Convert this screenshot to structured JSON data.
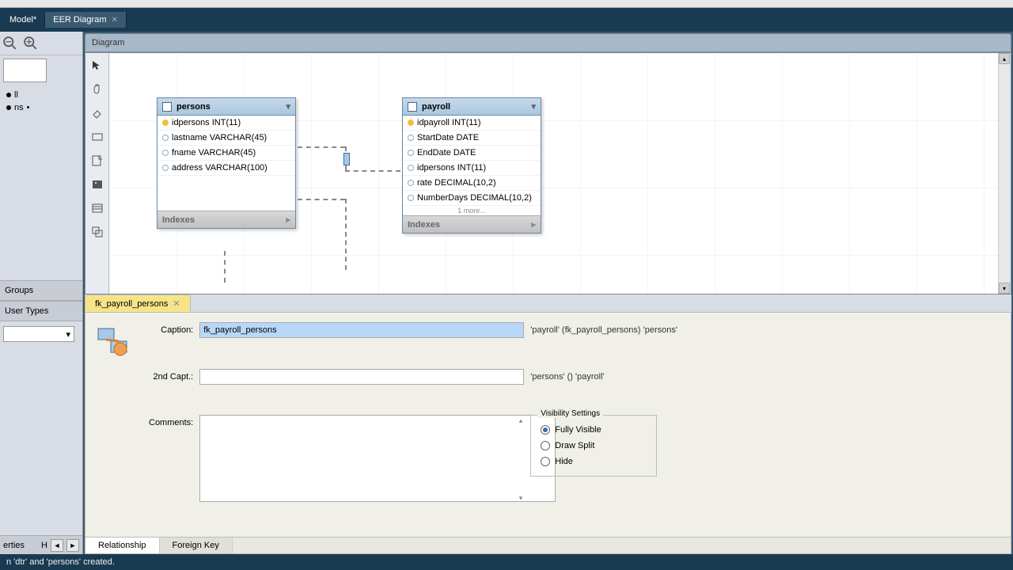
{
  "tabs": {
    "model": "Model*",
    "diagram": "EER Diagram"
  },
  "diagram_header": "Diagram",
  "left": {
    "tree_items": [
      "ll",
      "ns"
    ],
    "groups": "Groups",
    "user_types": "User Types"
  },
  "entities": {
    "persons": {
      "name": "persons",
      "cols": [
        {
          "key": true,
          "label": "idpersons INT(11)"
        },
        {
          "key": false,
          "label": "lastname VARCHAR(45)"
        },
        {
          "key": false,
          "label": "fname VARCHAR(45)"
        },
        {
          "key": false,
          "label": "address VARCHAR(100)"
        }
      ],
      "indexes": "Indexes"
    },
    "payroll": {
      "name": "payroll",
      "cols": [
        {
          "key": true,
          "label": "idpayroll INT(11)"
        },
        {
          "key": false,
          "label": "StartDate DATE"
        },
        {
          "key": false,
          "label": "EndDate DATE"
        },
        {
          "key": false,
          "label": "idpersons INT(11)"
        },
        {
          "key": false,
          "label": "rate DECIMAL(10,2)"
        },
        {
          "key": false,
          "label": "NumberDays DECIMAL(10,2)"
        }
      ],
      "more": "1 more...",
      "indexes": "Indexes"
    }
  },
  "prop": {
    "tab_name": "fk_payroll_persons",
    "caption_label": "Caption:",
    "caption_value": "fk_payroll_persons",
    "caption_desc": "'payroll' (fk_payroll_persons) 'persons'",
    "second_label": "2nd Capt.:",
    "second_value": "",
    "second_desc": "'persons' () 'payroll'",
    "comments_label": "Comments:",
    "comments_value": "",
    "visibility": {
      "legend": "Visibility Settings",
      "fully": "Fully Visible",
      "split": "Draw Split",
      "hide": "Hide"
    },
    "bottom_tabs": {
      "rel": "Relationship",
      "fk": "Foreign Key"
    }
  },
  "nav": {
    "erties": "erties",
    "h": "H"
  },
  "status": "n 'dtr' and 'persons' created."
}
